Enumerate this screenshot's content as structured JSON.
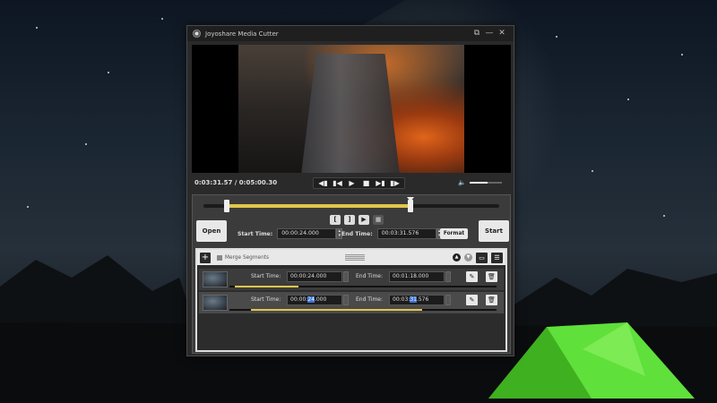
{
  "window": {
    "title": "Joyoshare Media Cutter",
    "controls": [
      "⧉",
      "—",
      "✕"
    ]
  },
  "player": {
    "time_display": "0:03:31.57 / 0:05:00.30",
    "transport": [
      "◀▮",
      "▮◀",
      "▶",
      "■",
      "▶▮",
      "▮▶"
    ],
    "volume_fraction": 0.55
  },
  "trimmer": {
    "range_start_fraction": 0.08,
    "range_end_fraction": 0.7,
    "marker_fraction": 0.7,
    "mini_buttons": [
      "[",
      "]",
      "▶",
      "■"
    ]
  },
  "editor": {
    "open_label": "Open",
    "start_label": "Start",
    "start_time_label": "Start Time:",
    "start_time_value": "00:00:24.000",
    "end_time_label": "End Time:",
    "end_time_value": "00:03:31.576",
    "format_label": "Format"
  },
  "segments": {
    "add_label": "+",
    "merge_label": "Merge Segments",
    "items": [
      {
        "start_label": "Start Time:",
        "start_value": "00:00:24.000",
        "end_label": "End Time:",
        "end_value": "00:01:18.000",
        "fill_start": 0.02,
        "fill_end": 0.26
      },
      {
        "start_label": "Start Time:",
        "start_value_pre": "00:00:",
        "start_value_hl": "24",
        "start_value_post": ".000",
        "end_label": "End Time:",
        "end_value_pre": "00:03:",
        "end_value_hl": "31",
        "end_value_post": ".576",
        "fill_start": 0.08,
        "fill_end": 0.72
      }
    ]
  }
}
